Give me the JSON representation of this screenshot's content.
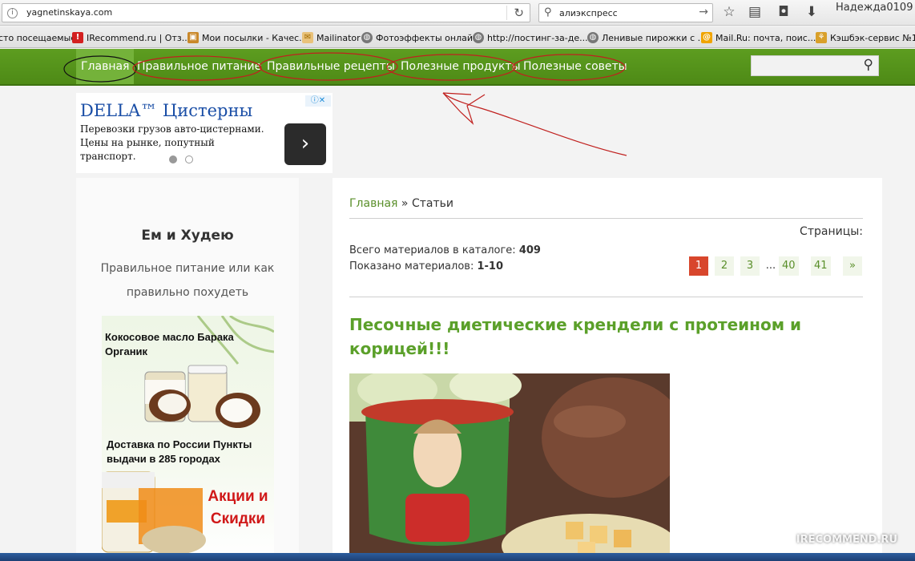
{
  "browser": {
    "url": "yagnetinskaya.com",
    "search_query": "алиэкспресс",
    "user_name": "Надежда0109",
    "bookmarks": [
      {
        "label": "сто посещаемые"
      },
      {
        "label": "IRecommend.ru | Отз..."
      },
      {
        "label": "Мои посылки - Качес..."
      },
      {
        "label": "Mailinator"
      },
      {
        "label": "Фотоэффекты онлайн"
      },
      {
        "label": "http://постинг-за-де..."
      },
      {
        "label": "Ленивые пирожки с ..."
      },
      {
        "label": "Mail.Ru: почта, поис..."
      },
      {
        "label": "Кэшбэк-сервис №1 -"
      }
    ]
  },
  "nav": {
    "items": [
      {
        "label": "Главная"
      },
      {
        "label": "Правильное питание"
      },
      {
        "label": "Правильные рецепты"
      },
      {
        "label": "Полезные продукты"
      },
      {
        "label": "Полезные советы"
      }
    ]
  },
  "ad": {
    "title": "DELLA™ Цистерны",
    "text": "Перевозки грузов авто-цистернами. Цены на рынке, попутный транспорт."
  },
  "sidebar": {
    "title": "Ем и Худею",
    "subtitle": "Правильное питание или как правильно похудеть",
    "banner": {
      "line1": "Кокосовое масло Барака Органик",
      "line2": "Доставка по России Пункты выдачи в 285 городах",
      "line3": "Акции и Скидки"
    }
  },
  "main": {
    "breadcrumb_home": "Главная",
    "breadcrumb_sep": " » ",
    "breadcrumb_current": "Статьи",
    "pages_label": "Страницы:",
    "total_label": "Всего материалов в каталоге: ",
    "total_value": "409",
    "shown_label": "Показано материалов: ",
    "shown_value": "1-10",
    "pagination": [
      "1",
      "2",
      "3",
      "...",
      "40",
      "41",
      "»"
    ],
    "article_title": "Песочные диетические крендели с протеином и корицей!!!"
  },
  "watermark": "IRECOMMEND.RU",
  "colors": {
    "nav_green": "#5d9d20",
    "accent_green": "#5ba02a",
    "active_page": "#d8462c",
    "scribble_red": "#c0201e"
  }
}
